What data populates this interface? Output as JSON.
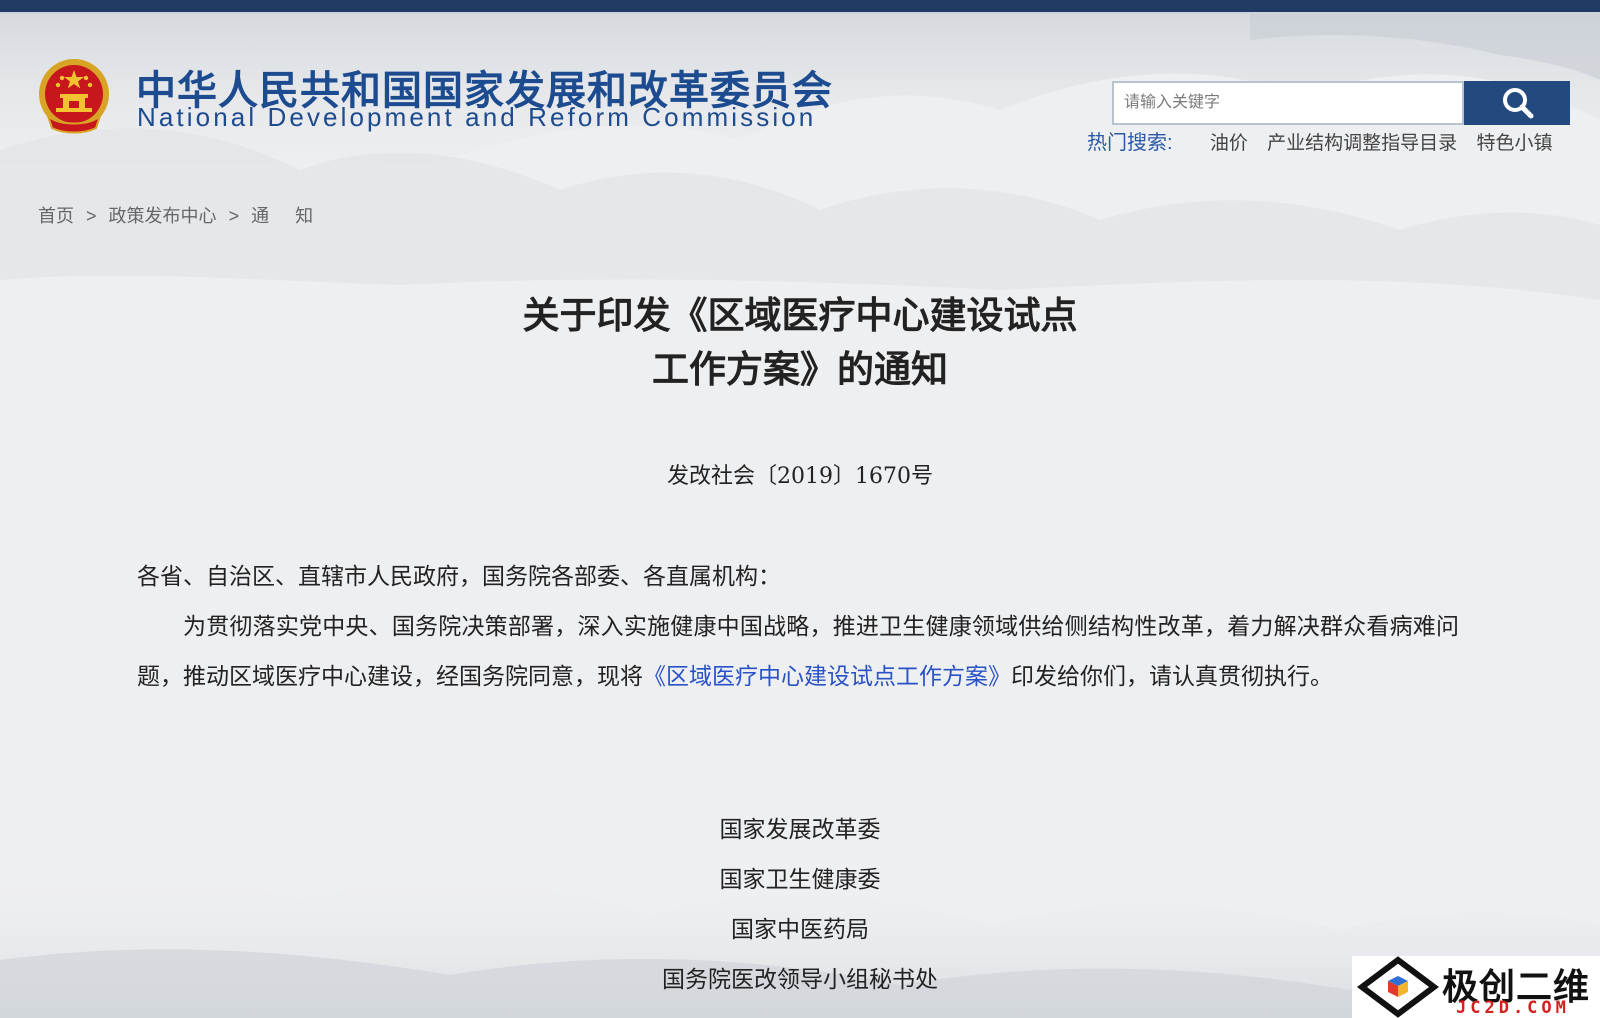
{
  "colors": {
    "top_bar": "#1f3b63",
    "brand_blue": "#1c4b8f",
    "search_button": "#24497f",
    "hot_label": "#2a5aa5",
    "link_blue": "#2a52c8",
    "watermark_red": "#d62020"
  },
  "header": {
    "emblem": "national-emblem-icon",
    "title_cn": "中华人民共和国国家发展和改革委员会",
    "title_en": "National Development and Reform Commission"
  },
  "search": {
    "placeholder": "请输入关键字",
    "button_icon": "search-icon",
    "hot_label": "热门搜索:",
    "hot_items": [
      "油价",
      "产业结构调整指导目录",
      "特色小镇"
    ]
  },
  "breadcrumb": {
    "home": "首页",
    "separator": ">",
    "section": "政策发布中心",
    "current": "通知"
  },
  "document": {
    "title_line1": "关于印发《区域医疗中心建设试点",
    "title_line2": "工作方案》的通知",
    "number": "发改社会〔2019〕1670号",
    "salutation": "各省、自治区、直辖市人民政府，国务院各部委、各直属机构：",
    "body_before_link": "为贯彻落实党中央、国务院决策部署，深入实施健康中国战略，推进卫生健康领域供给侧结构性改革，着力解决群众看病难问题，推动区域医疗中心建设，经国务院同意，现将",
    "body_link": "《区域医疗中心建设试点工作方案》",
    "body_after_link": "印发给你们，请认真贯彻执行。",
    "signatures": [
      "国家发展改革委",
      "国家卫生健康委",
      "国家中医药局",
      "国务院医改领导小组秘书处"
    ]
  },
  "watermark": {
    "logo_icon": "diamond-cube-logo-icon",
    "text_cn": "极创二维",
    "text_en": "JC2D.COM"
  }
}
